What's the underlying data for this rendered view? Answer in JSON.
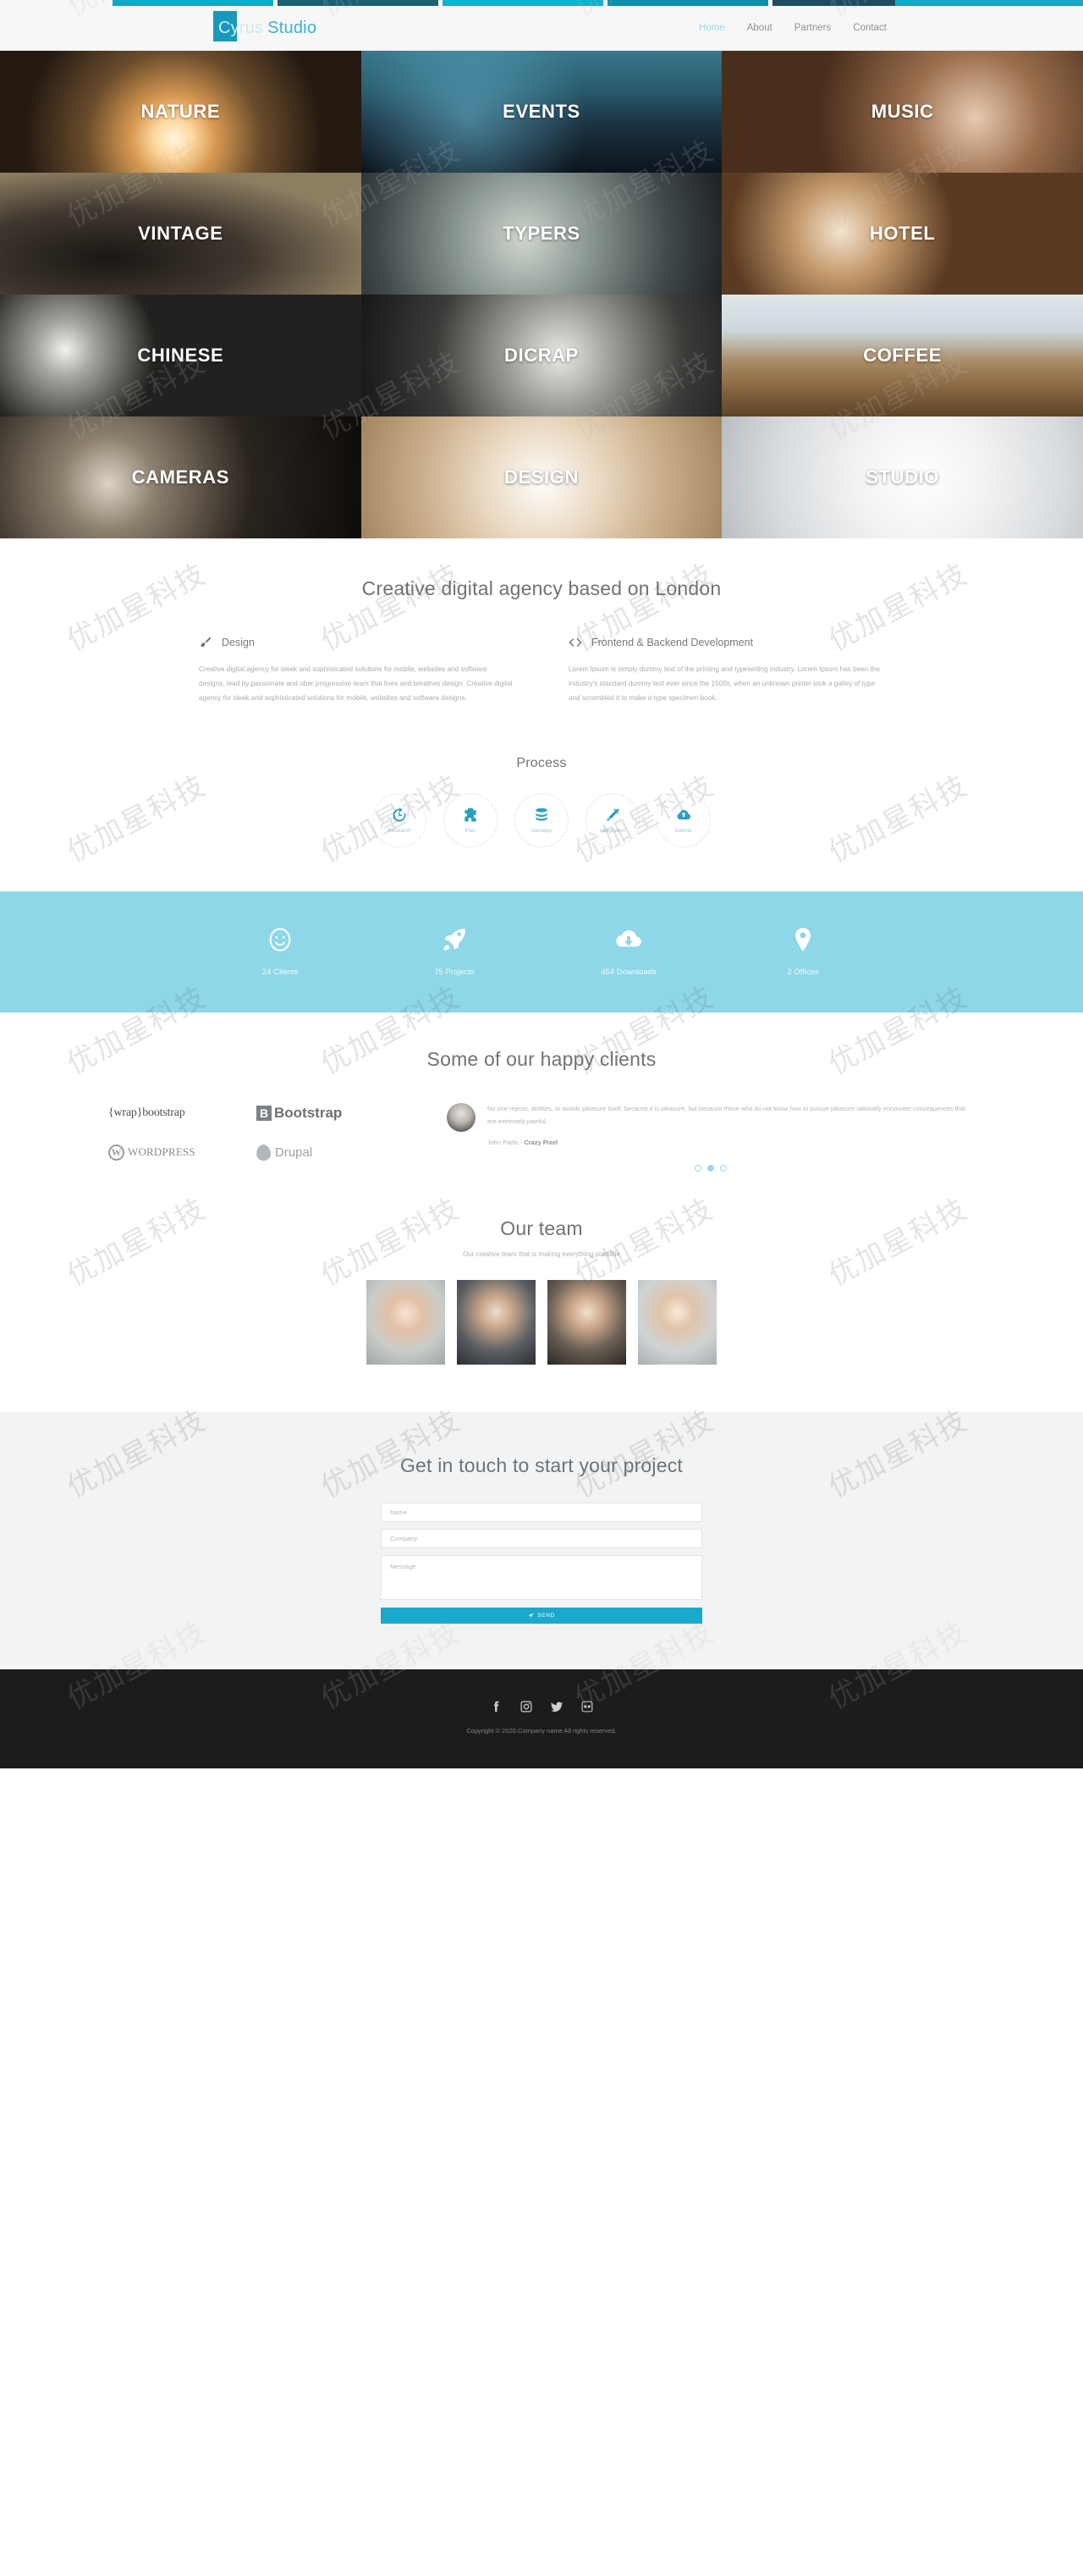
{
  "theme": {
    "accent": "#1899ba",
    "accent_light": "#8ed7e8",
    "stats_bg": "#8ed7e8",
    "footer_bg": "#1c1c1c",
    "contact_bg": "#f2f3f4",
    "header_bg": "#f7f7f7"
  },
  "header": {
    "brand_first": "Cyrus",
    "brand_second": "Studio",
    "nav": [
      {
        "label": "Home",
        "active": true
      },
      {
        "label": "About",
        "active": false
      },
      {
        "label": "Partners",
        "active": false
      },
      {
        "label": "Contact",
        "active": false
      }
    ]
  },
  "grid": {
    "tiles": [
      {
        "label": "NATURE",
        "style": "bg-nature"
      },
      {
        "label": "EVENTS",
        "style": "bg-events"
      },
      {
        "label": "MUSIC",
        "style": "bg-music"
      },
      {
        "label": "VINTAGE",
        "style": "bg-vintage"
      },
      {
        "label": "TYPERS",
        "style": "bg-typers"
      },
      {
        "label": "HOTEL",
        "style": "bg-hotel"
      },
      {
        "label": "CHINESE",
        "style": "bg-chinese"
      },
      {
        "label": "DICRAP",
        "style": "bg-dicrap"
      },
      {
        "label": "COFFEE",
        "style": "bg-coffee"
      },
      {
        "label": "CAMERAS",
        "style": "bg-cameras"
      },
      {
        "label": "DESIGN",
        "style": "bg-design"
      },
      {
        "label": "STUDIO",
        "style": "bg-studio"
      }
    ]
  },
  "about": {
    "title": "Creative digital agency based on London",
    "columns": [
      {
        "icon": "brush-icon",
        "heading": "Design",
        "body": "Creative digital agency for sleek and sophisticated solutions for mobile, websites and software designs, lead by passionate and uber progressive team that lives and breathes design. Creative digital agency for sleek and sophisticated solutions for mobile, websites and software designs."
      },
      {
        "icon": "code-icon",
        "heading": "Frontend & Backend Development",
        "body": "Lorem Ipsum is simply dummy text of the printing and typesetting industry. Lorem Ipsum has been the industry's standard dummy text ever since the 1500s, when an unknown printer took a galley of type and scrambled it to make a type specimen book."
      }
    ]
  },
  "process": {
    "title": "Process",
    "steps": [
      {
        "icon": "history-icon",
        "label": "Research"
      },
      {
        "icon": "puzzle-icon",
        "label": "Plan"
      },
      {
        "icon": "database-icon",
        "label": "Develop"
      },
      {
        "icon": "magic-wand-icon",
        "label": "Integration"
      },
      {
        "icon": "cloud-up-icon",
        "label": "Deliver"
      }
    ]
  },
  "stats": [
    {
      "icon": "smiley-icon",
      "label": "24 Clients"
    },
    {
      "icon": "rocket-icon",
      "label": "75 Projects"
    },
    {
      "icon": "cloud-download-icon",
      "label": "454 Downloads"
    },
    {
      "icon": "map-pin-icon",
      "label": "2 Offices"
    }
  ],
  "clients": {
    "title": "Some of our happy clients",
    "logos": [
      {
        "name": "wrapbootstrap-logo",
        "text": "{wrap}bootstrap"
      },
      {
        "name": "bootstrap-logo",
        "mark": "B",
        "text": "Bootstrap"
      },
      {
        "name": "wordpress-logo",
        "mark": "W",
        "text": "WORDPRESS"
      },
      {
        "name": "drupal-logo",
        "text": "Drupal"
      }
    ],
    "testimonial": {
      "quote": "No one rejects, dislikes, or avoids pleasure itself, because it is pleasure, but because those who do not know how to pursue pleasure rationally encounter consequences that are extremely painful.",
      "author_prefix": "John Partic - ",
      "author_company": "Crazy Pixel"
    },
    "dots": 3,
    "active_dot": 1
  },
  "team": {
    "title": "Our team",
    "subtitle": "Our creative team that is making everything possible",
    "members": [
      {
        "name": "team-member-1",
        "style": "m1"
      },
      {
        "name": "team-member-2",
        "style": "m2"
      },
      {
        "name": "team-member-3",
        "style": "m3"
      },
      {
        "name": "team-member-4",
        "style": "m4"
      }
    ]
  },
  "contact": {
    "title": "Get in touch to start your project",
    "fields": {
      "name_placeholder": "Name",
      "company_placeholder": "Company",
      "message_placeholder": "Message"
    },
    "send_label": "SEND"
  },
  "footer": {
    "socials": [
      {
        "icon": "facebook-icon"
      },
      {
        "icon": "instagram-icon"
      },
      {
        "icon": "twitter-icon"
      },
      {
        "icon": "flickr-icon"
      }
    ],
    "copyright": "Copyright © 2020.Company name All rights reserved."
  },
  "watermark": {
    "text": "优加星科技"
  }
}
